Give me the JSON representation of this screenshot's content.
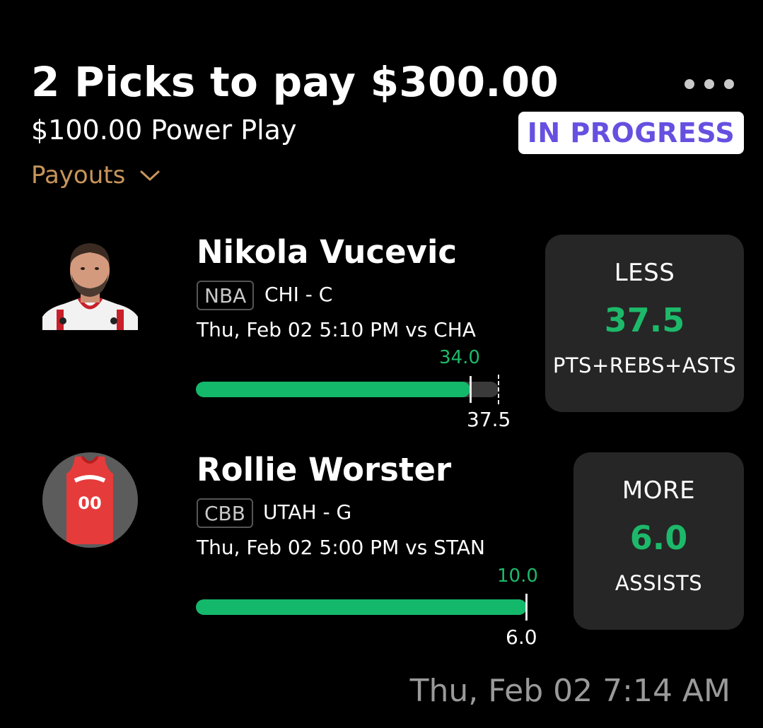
{
  "header": {
    "title": "2 Picks to pay $300.00",
    "subtitle": "$100.00 Power Play",
    "payouts_label": "Payouts",
    "status": "IN PROGRESS"
  },
  "picks": [
    {
      "player": "Nikola Vucevic",
      "league": "NBA",
      "team_pos": "CHI - C",
      "game": "Thu, Feb 02 5:10 PM  vs CHA",
      "current_value": "34.0",
      "line_value": "37.5",
      "progress": 0.907,
      "direction": "LESS",
      "card_line": "37.5",
      "stat": "PTS+REBS+ASTS"
    },
    {
      "player": "Rollie Worster",
      "league": "CBB",
      "team_pos": "UTAH - G",
      "game": "Thu, Feb 02 5:00 PM  vs STAN",
      "current_value": "10.0",
      "line_value": "6.0",
      "progress": 1.0,
      "direction": "MORE",
      "card_line": "6.0",
      "stat": "ASSISTS",
      "jersey_number": "00"
    }
  ],
  "footer": {
    "timestamp": "Thu, Feb 02 7:14 AM"
  },
  "colors": {
    "green": "#14b86a",
    "status_text": "#6650e0",
    "payouts": "#c8955a"
  }
}
